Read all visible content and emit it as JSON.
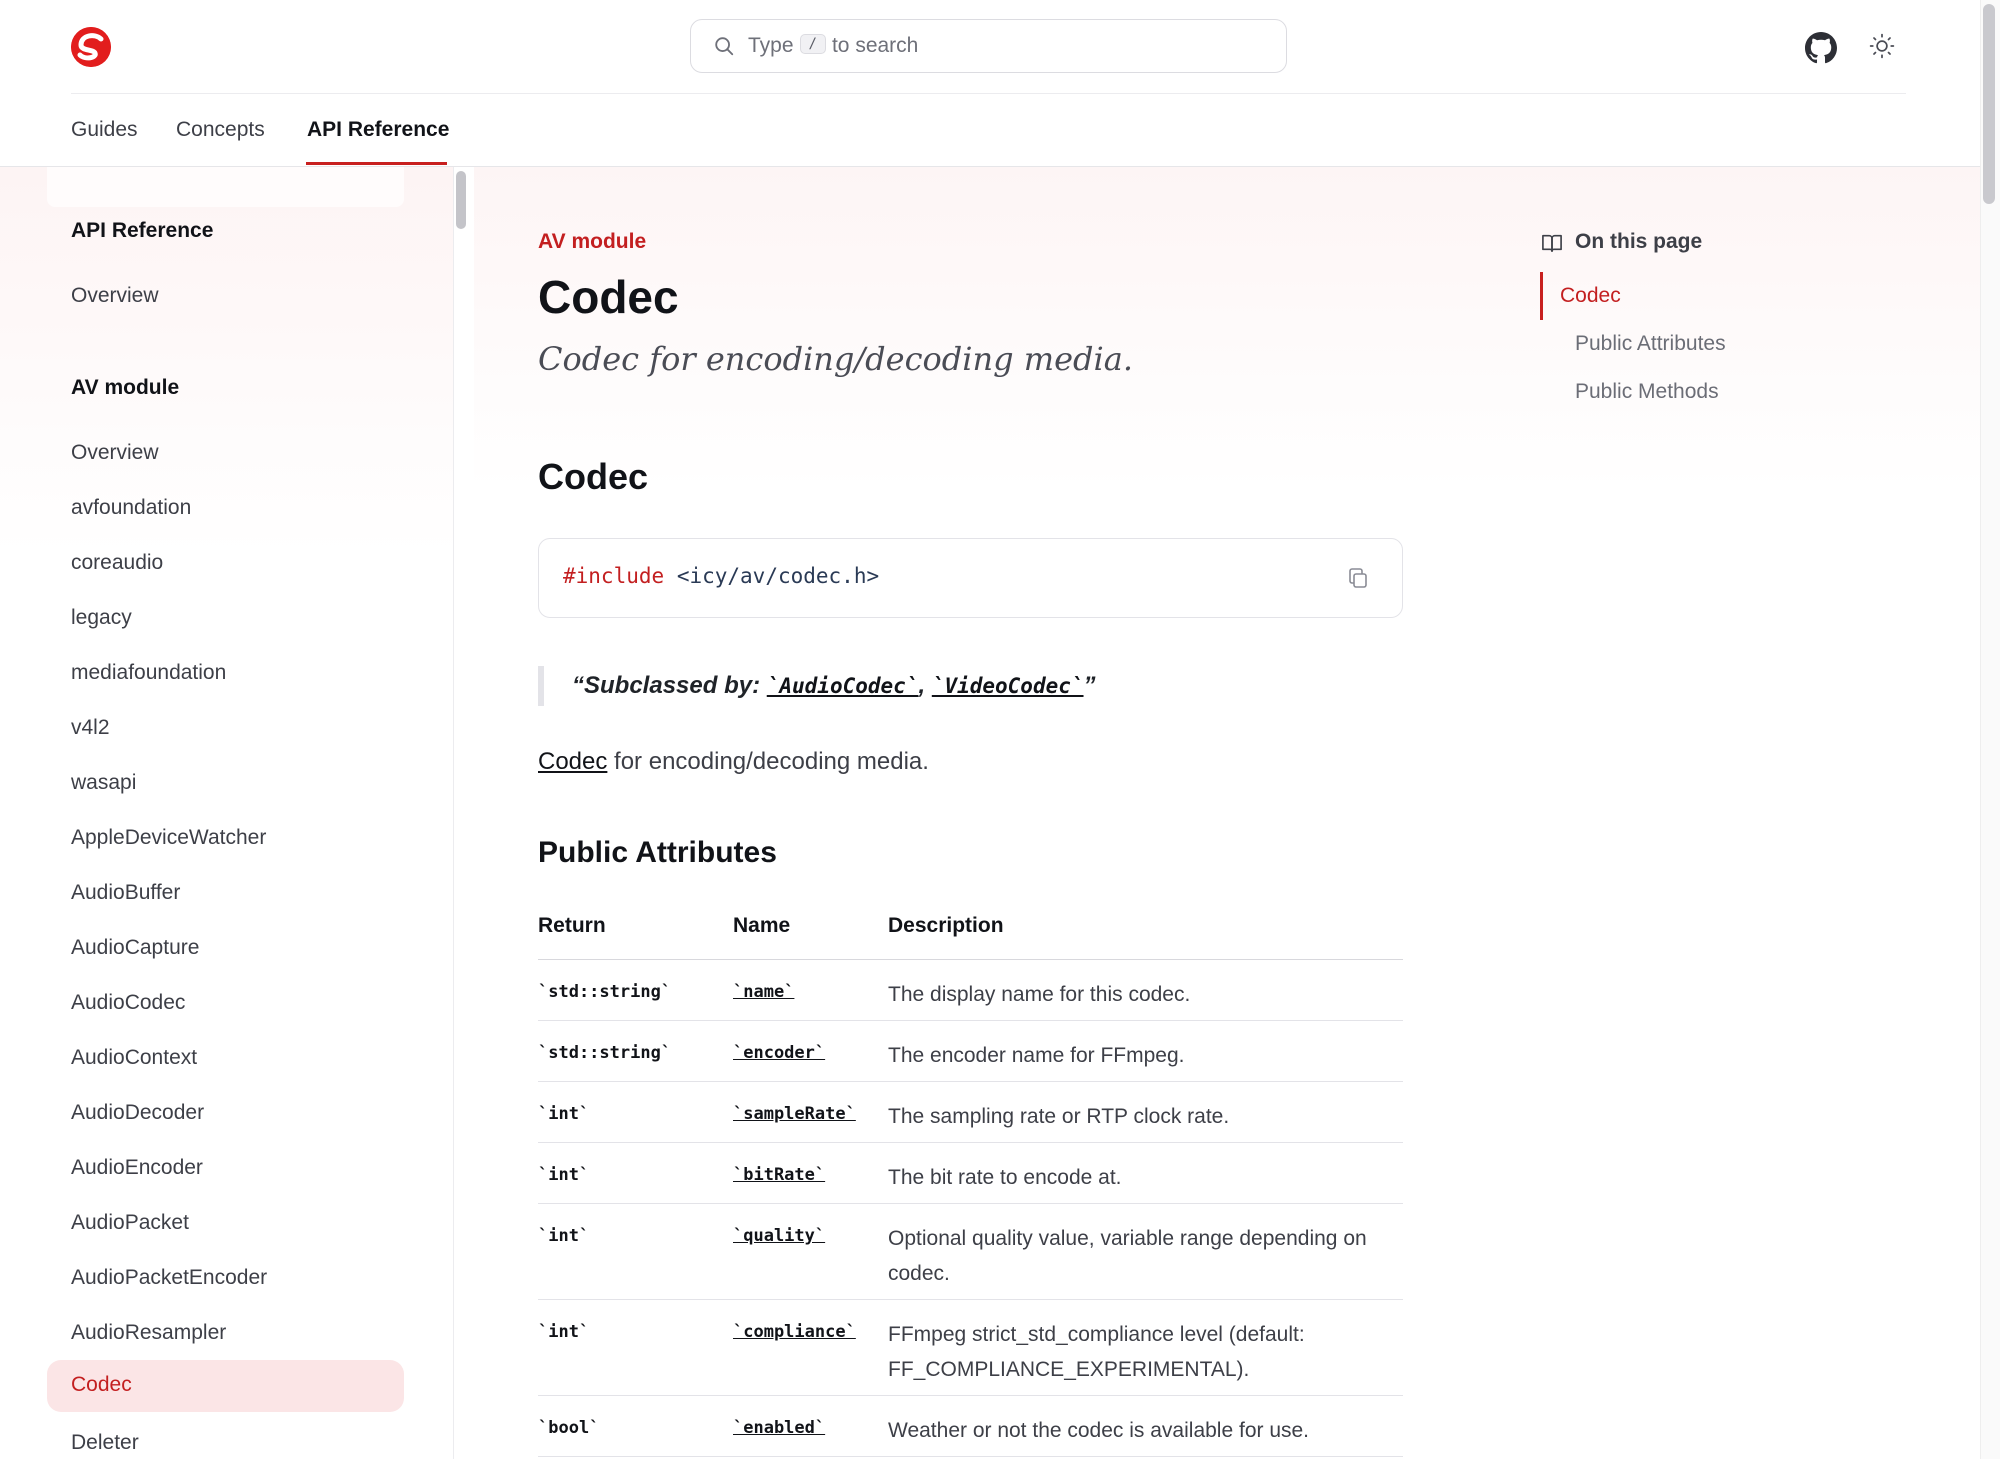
{
  "header": {
    "search_prefix": "Type",
    "search_key": "/",
    "search_suffix": "to search",
    "icons": {
      "logo": "logo-icon",
      "search": "search-icon",
      "github": "github-icon",
      "theme": "sun-icon"
    }
  },
  "topnav": {
    "tabs": [
      {
        "label": "Guides",
        "active": false
      },
      {
        "label": "Concepts",
        "active": false
      },
      {
        "label": "API Reference",
        "active": true
      }
    ]
  },
  "sidebar": {
    "section1": "API Reference",
    "section1_items": [
      "Overview"
    ],
    "section2": "AV module",
    "items": [
      "Overview",
      "avfoundation",
      "coreaudio",
      "legacy",
      "mediafoundation",
      "v4l2",
      "wasapi",
      "AppleDeviceWatcher",
      "AudioBuffer",
      "AudioCapture",
      "AudioCodec",
      "AudioContext",
      "AudioDecoder",
      "AudioEncoder",
      "AudioPacket",
      "AudioPacketEncoder",
      "AudioResampler",
      "Codec",
      "Deleter"
    ],
    "active_item": "Codec"
  },
  "main": {
    "eyebrow": "AV module",
    "title": "Codec",
    "lead": "Codec for encoding/decoding media.",
    "section_title": "Codec",
    "code": {
      "keyword": "#include",
      "path": "<icy/av/codec.h>"
    },
    "quote": {
      "prefix": "“Subclassed by: ",
      "link1": "`AudioCodec`",
      "separator": ", ",
      "link2": "`VideoCodec`",
      "suffix": "”"
    },
    "paragraph": {
      "link": "Codec",
      "text": " for encoding/decoding media."
    },
    "attributes_title": "Public Attributes",
    "table": {
      "headers": [
        "Return",
        "Name",
        "Description"
      ],
      "rows": [
        {
          "return": "`std::string`",
          "name": "`name`",
          "description": "The display name for this codec."
        },
        {
          "return": "`std::string`",
          "name": "`encoder`",
          "description": "The encoder name for FFmpeg."
        },
        {
          "return": "`int`",
          "name": "`sampleRate`",
          "description": "The sampling rate or RTP clock rate."
        },
        {
          "return": "`int`",
          "name": "`bitRate`",
          "description": "The bit rate to encode at."
        },
        {
          "return": "`int`",
          "name": "`quality`",
          "description": "Optional quality value, variable range depending on codec."
        },
        {
          "return": "`int`",
          "name": "`compliance`",
          "description": "FFmpeg strict_std_compliance level (default: FF_COMPLIANCE_EXPERIMENTAL)."
        },
        {
          "return": "`bool`",
          "name": "`enabled`",
          "description": "Weather or not the codec is available for use."
        }
      ]
    }
  },
  "toc": {
    "title": "On this page",
    "items": [
      "Codec",
      "Public Attributes",
      "Public Methods"
    ],
    "active": "Codec"
  },
  "colors": {
    "accent": "#c8201f",
    "active_bg": "#fbe5e6"
  }
}
